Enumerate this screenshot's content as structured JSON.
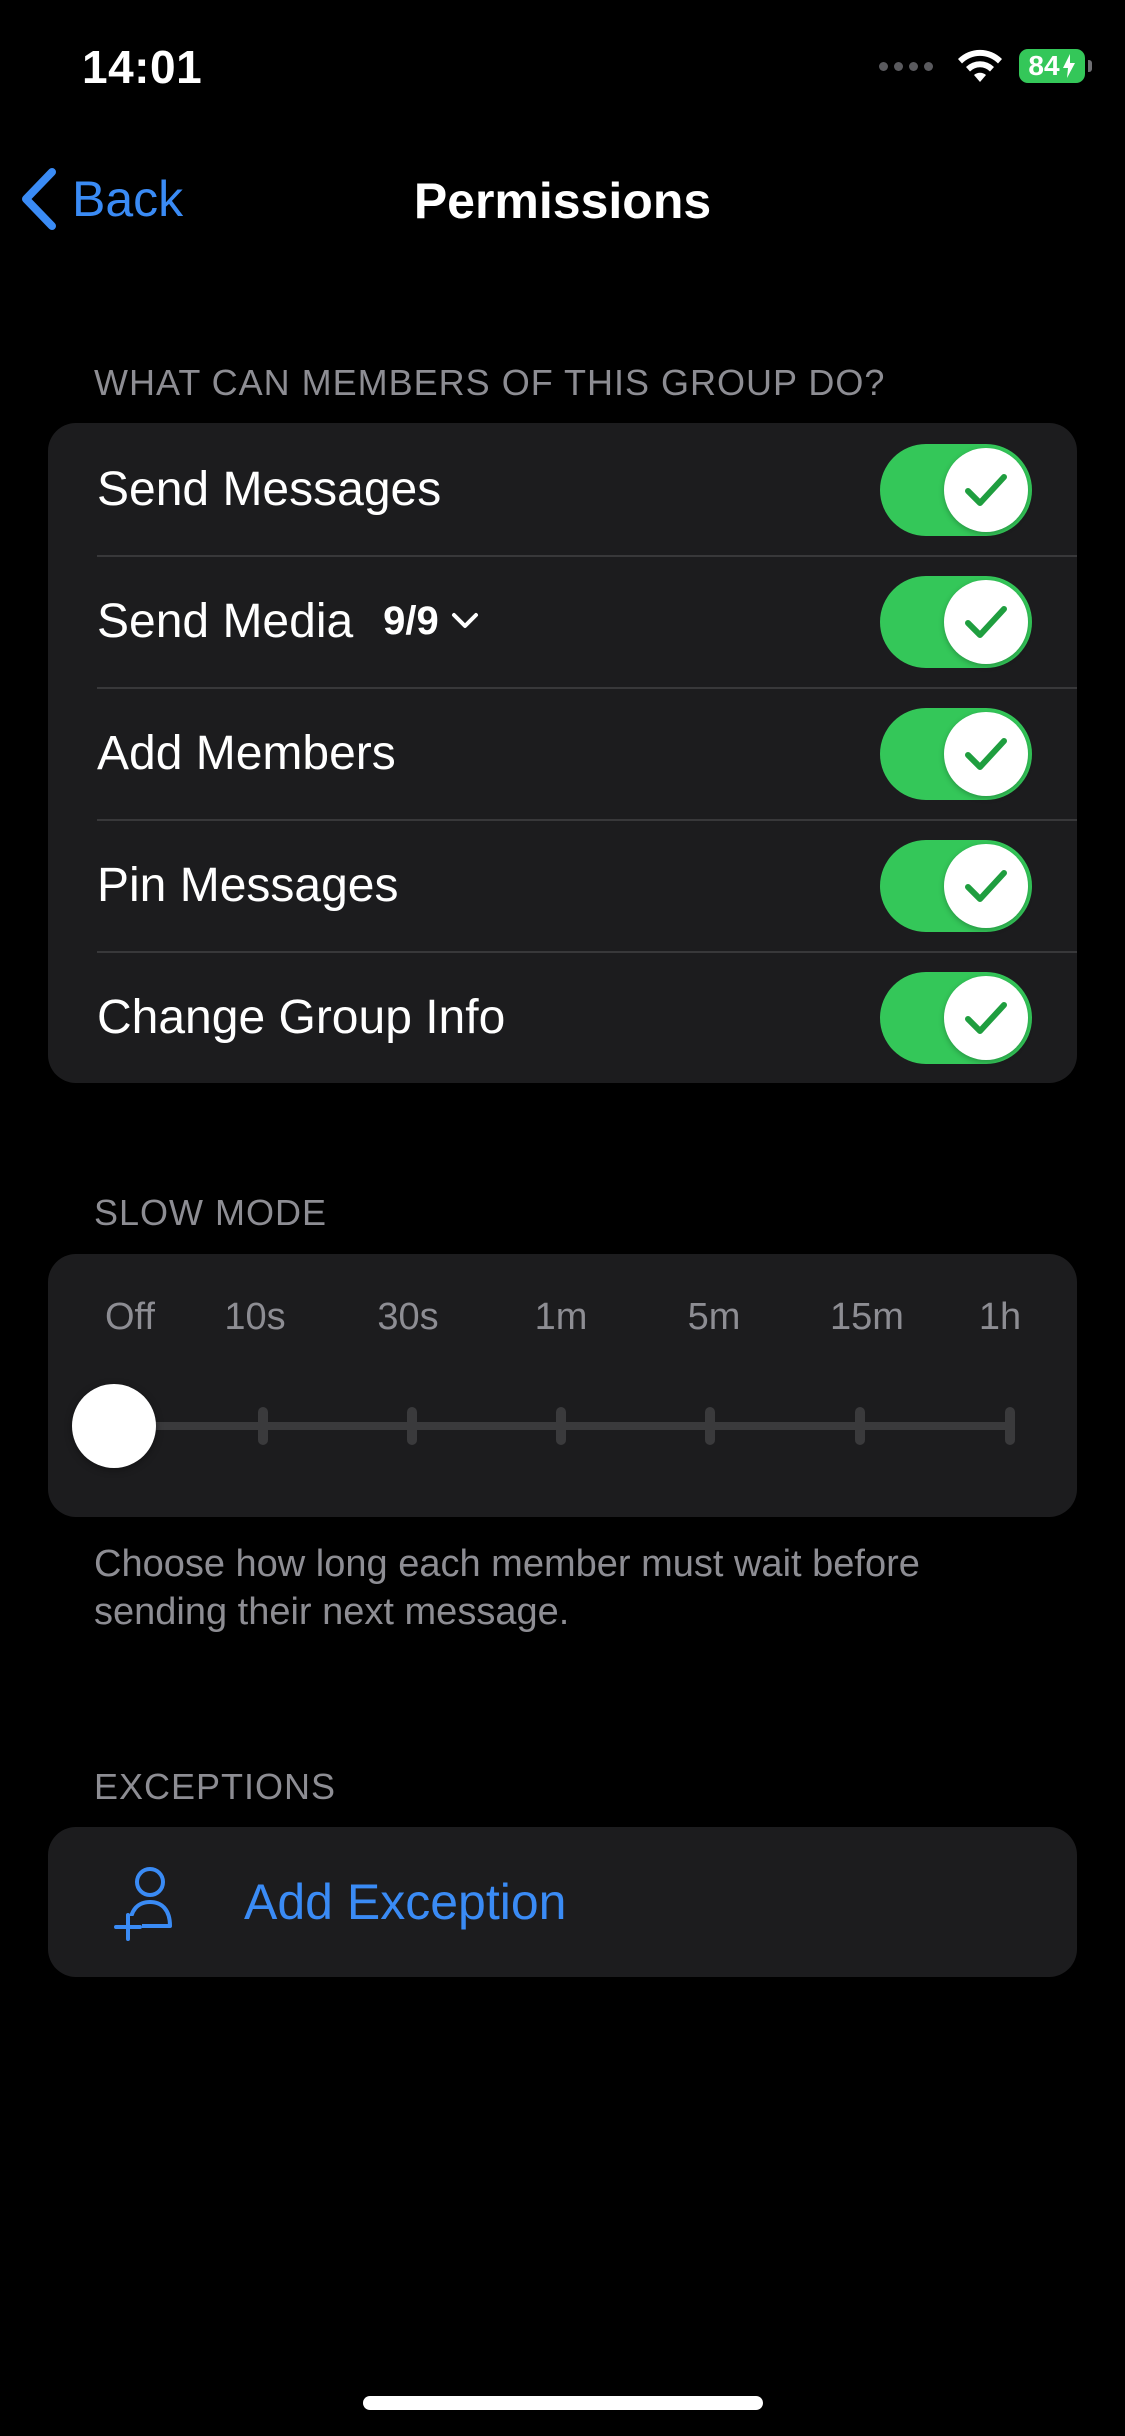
{
  "status_bar": {
    "time": "14:01",
    "battery": "84"
  },
  "nav": {
    "back_label": "Back",
    "title": "Permissions"
  },
  "permissions_section": {
    "header": "WHAT CAN MEMBERS OF THIS GROUP DO?",
    "items": [
      {
        "label": "Send Messages",
        "enabled": true
      },
      {
        "label": "Send Media",
        "count": "9/9",
        "enabled": true
      },
      {
        "label": "Add Members",
        "enabled": true
      },
      {
        "label": "Pin Messages",
        "enabled": true
      },
      {
        "label": "Change Group Info",
        "enabled": true
      }
    ]
  },
  "slow_mode": {
    "header": "SLOW MODE",
    "options": [
      "Off",
      "10s",
      "30s",
      "1m",
      "5m",
      "15m",
      "1h"
    ],
    "selected": "Off",
    "footer": "Choose how long each member must wait before sending their next message."
  },
  "exceptions": {
    "header": "EXCEPTIONS",
    "add_label": "Add Exception"
  },
  "colors": {
    "accent": "#3a8bf5",
    "toggle_on": "#34c759",
    "card_bg": "#1c1c1e",
    "secondary_text": "#8d8d93"
  }
}
